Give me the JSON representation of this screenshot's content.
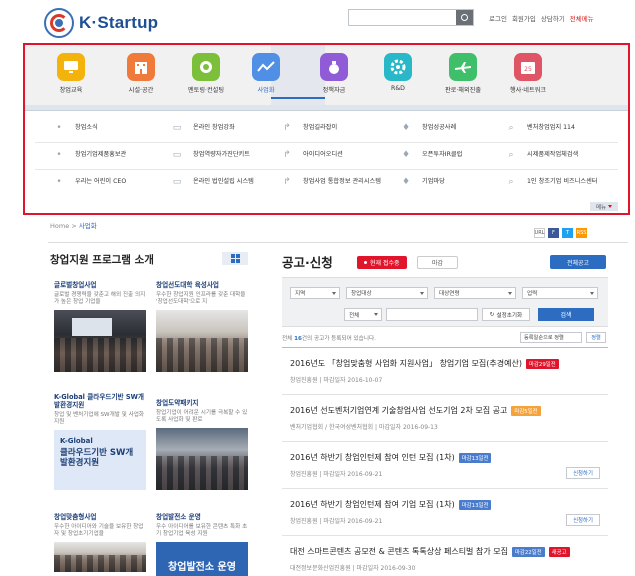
{
  "header": {
    "logo_text_prefix": "K·",
    "logo_text": "Startup",
    "search_placeholder": "",
    "links": [
      "로그인",
      "회원가입",
      "상담하기",
      "전체메뉴"
    ]
  },
  "categories": [
    {
      "label": "창업교육",
      "icon": "monitor-icon",
      "color": "#f3b20c"
    },
    {
      "label": "시설·공간",
      "icon": "building-icon",
      "color": "#f07a3a"
    },
    {
      "label": "멘토링·컨설팅",
      "icon": "mentoring-icon",
      "color": "#7bbf3a"
    },
    {
      "label": "사업화",
      "icon": "chart-line-icon",
      "color": "#4f8fe6",
      "active": true
    },
    {
      "label": "정책자금",
      "icon": "money-bag-icon",
      "color": "#8f5bd6"
    },
    {
      "label": "R&D",
      "icon": "gear-icon",
      "color": "#28b8c8"
    },
    {
      "label": "판로·해외진출",
      "icon": "airplane-icon",
      "color": "#3fbf6a"
    },
    {
      "label": "행사·네트워크",
      "icon": "calendar-icon",
      "color": "#e05565"
    }
  ],
  "active_category": "사업화",
  "submenu": [
    [
      "창업소식",
      "온라인 창업강좌",
      "창업길라잡이",
      "창업성공사례",
      "벤처창업업지 114"
    ],
    [
      "창업기업제품홍보관",
      "창업역량자가진단키트",
      "아이디어오디션",
      "오픈투자IR클럽",
      "시제품제작업체검색"
    ],
    [
      "우리는 어린이 CEO",
      "온라인 법인설립 시스템",
      "창업사업 통합정보 관리시스템",
      "기업마당",
      "1인 창조기업 비즈니스센터"
    ]
  ],
  "more_label": "메뉴",
  "breadcrumb": {
    "home": "Home",
    "sep": ">",
    "current": "사업화"
  },
  "share": [
    "URL",
    "F",
    "T",
    "RSS"
  ],
  "programs": {
    "title": "창업지원 프로그램 소개",
    "items": [
      {
        "name": "글로벌창업사업",
        "desc": "글로벌 경쟁력을 갖춘고 해외 진출 의지가 높은 창업 기업을"
      },
      {
        "name": "창업선도대학 육성사업",
        "desc": "우수한 창업지원 인프라를 갖춘 대학을 '창업선도대학'으로 지"
      },
      {
        "name": "K-Global 클라우드기반 SW개발환경지원",
        "desc": "창업 및 벤처기업에 SW개발 및 사업화 지원"
      },
      {
        "name": "창업도약패키지",
        "desc": "창업기업이 어려운 시기를 극복할 수 있도록 사업화 및 판로"
      },
      {
        "name": "창업맞춤형사업",
        "desc": "우수한 아이디어와 기술을 보유한 창업자 및 창업초기기업을"
      },
      {
        "name": "창업발전소 운영",
        "desc": "우수 아이디어를 보유한 콘텐츠 특화 초기 창업기업 육성 지원"
      }
    ],
    "kglobal_line1": "K-Global",
    "kglobal_line2": "클라우드기반 SW개발환경지원",
    "banner_text": "창업발전소 운영"
  },
  "notices": {
    "title": "공고·신청",
    "tab_active": "현재 접수중",
    "tab_other": "마감",
    "all_button": "전체공고",
    "filters": [
      "지역",
      "창업대상",
      "대상연령",
      "업력"
    ],
    "filter_type": "전체",
    "reset_label": "설정초기화",
    "search_label": "검색",
    "count_prefix": "전체 ",
    "count": "16",
    "count_suffix": "건의 공고가 등록되어 있습니다.",
    "sort_label": "등록일순으로 정렬",
    "sort_go": "정렬",
    "items": [
      {
        "title": "2016년도 「창업맞춤형 사업화 지원사업」 창업기업 모집(추경예산)",
        "badges": [
          {
            "text": "마감29일전",
            "color": "red"
          }
        ],
        "meta": "창업진흥원  |  마감일자 2016-10-07",
        "apply": ""
      },
      {
        "title": "2016년 선도벤처기업연계 기술창업사업 선도기업 2차 모집 공고",
        "badges": [
          {
            "text": "마감5일전",
            "color": "orange"
          }
        ],
        "meta": "벤처기업협회 / 한국여성벤처협회  |  마감일자 2016-09-13",
        "apply": ""
      },
      {
        "title": "2016년 하반기 창업인턴제 참여 인턴 모집 (1차)",
        "badges": [
          {
            "text": "마감13일전",
            "color": "blue"
          }
        ],
        "meta": "창업진흥원  |  마감일자 2016-09-21",
        "apply": "신청하기"
      },
      {
        "title": "2016년 하반기 창업인턴제 참여 기업 모집 (1차)",
        "badges": [
          {
            "text": "마감13일전",
            "color": "blue"
          }
        ],
        "meta": "창업진흥원  |  마감일자 2016-09-21",
        "apply": "신청하기"
      },
      {
        "title": "대전 스마트콘텐츠 공모전 & 콘텐츠 톡톡상상 페스티벌 참가 모집",
        "badges": [
          {
            "text": "마감22일전",
            "color": "blue"
          },
          {
            "text": "새공고",
            "color": "red"
          }
        ],
        "meta": "대전정보문화산업진흥원  |  마감일자 2016-09-30",
        "apply": ""
      }
    ]
  }
}
